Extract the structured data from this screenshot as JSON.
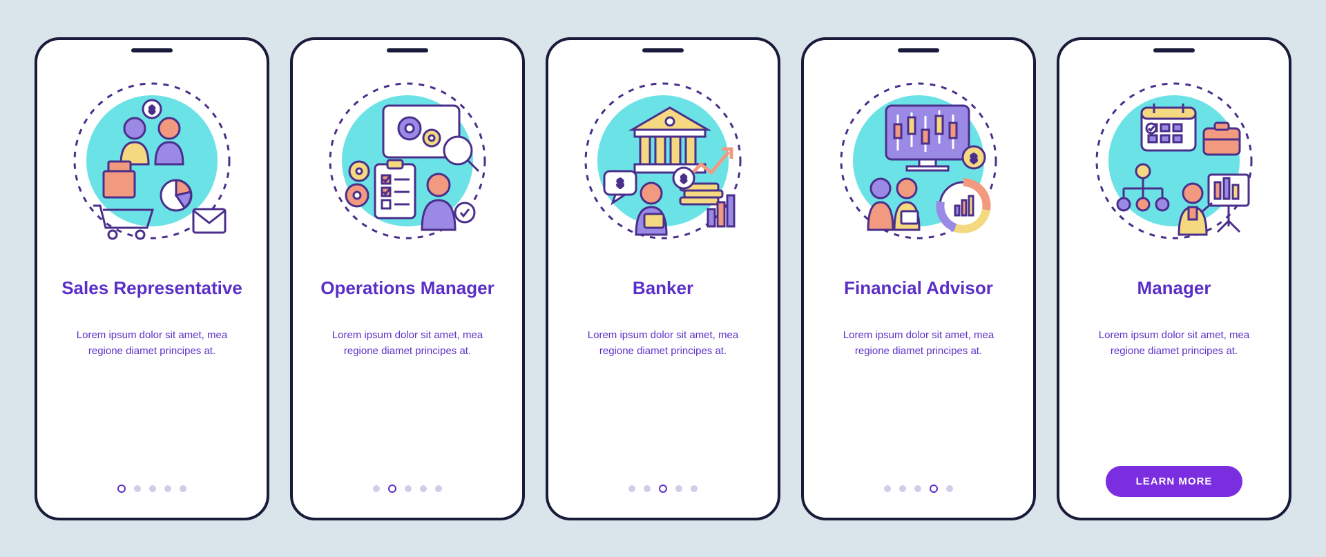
{
  "common_desc": "Lorem ipsum dolor sit amet, mea regione diamet principes at.",
  "cta_label": "LEARN MORE",
  "cards": [
    {
      "title": "Sales Representative",
      "icon": "sales-icon"
    },
    {
      "title": "Operations Manager",
      "icon": "operations-icon"
    },
    {
      "title": "Banker",
      "icon": "banker-icon"
    },
    {
      "title": "Financial Advisor",
      "icon": "finance-icon"
    },
    {
      "title": "Manager",
      "icon": "manager-icon"
    }
  ],
  "colors": {
    "stroke": "#4a2e8b",
    "cyan": "#6be3e6",
    "purple": "#9a8ae6",
    "yellow": "#f5d980",
    "coral": "#f29a80",
    "white": "#ffffff"
  }
}
